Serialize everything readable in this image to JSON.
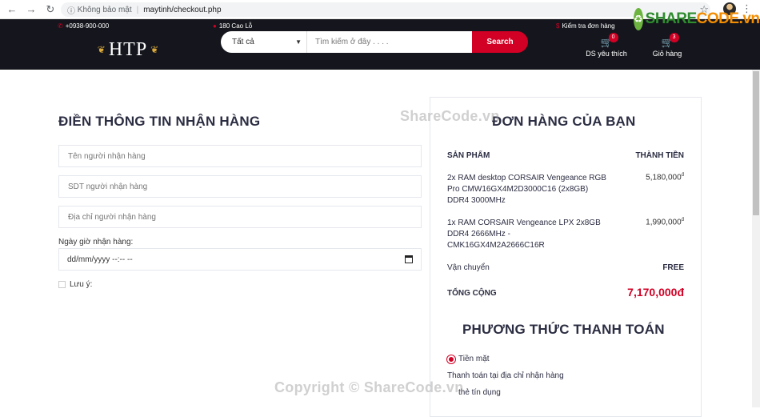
{
  "browser": {
    "security": "Không bảo mật",
    "url": "maytinh/checkout.php"
  },
  "watermark": {
    "logo_text_a": "SHARE",
    "logo_text_b": "CODE.vn",
    "overlay": "ShareCode.vn",
    "footer": "Copyright © ShareCode.vn"
  },
  "topbar": {
    "phone": "+0938-900-000",
    "address": "180 Cao Lỗ",
    "order_check": "Kiểm tra đơn hàng"
  },
  "brand": {
    "name": "HTP"
  },
  "search": {
    "category": "Tất cả",
    "placeholder": "Tìm kiếm ở đây . . . .",
    "button": "Search"
  },
  "wishlist": {
    "label": "DS yêu thích",
    "count": "0"
  },
  "cart": {
    "label": "Giỏ hàng",
    "count": "3"
  },
  "shipping_form": {
    "title": "ĐIỀN THÔNG TIN NHẬN HÀNG",
    "name_placeholder": "Tên người nhận hàng",
    "phone_placeholder": "SDT người nhận hàng",
    "address_placeholder": "Địa chỉ người nhận hàng",
    "date_label": "Ngày giờ nhận hàng:",
    "date_value": "dd/mm/yyyy --:-- --",
    "note_label": "Lưu ý:"
  },
  "order": {
    "title": "ĐƠN HÀNG CỦA BẠN",
    "col_product": "SẢN PHẨM",
    "col_total": "THÀNH TIỀN",
    "items": [
      {
        "name": "2x RAM desktop CORSAIR Vengeance RGB Pro CMW16GX4M2D3000C16 (2x8GB) DDR4 3000MHz",
        "price": "5,180,000",
        "currency": "đ"
      },
      {
        "name": "1x RAM CORSAIR Vengeance LPX 2x8GB DDR4 2666MHz - CMK16GX4M2A2666C16R",
        "price": "1,990,000",
        "currency": "đ"
      }
    ],
    "shipping_label": "Vận chuyển",
    "shipping_value": "FREE",
    "total_label": "TỔNG CỘNG",
    "total_value": "7,170,000đ"
  },
  "payment": {
    "title": "PHƯƠNG THỨC THANH TOÁN",
    "option_cash": "Tiền mặt",
    "cash_note": "Thanh toán tại địa chỉ nhận hàng",
    "option_card": "thẻ tín dụng"
  },
  "colors": {
    "accent": "#d10024",
    "header_bg": "#15161d",
    "heading": "#2b2d42"
  }
}
